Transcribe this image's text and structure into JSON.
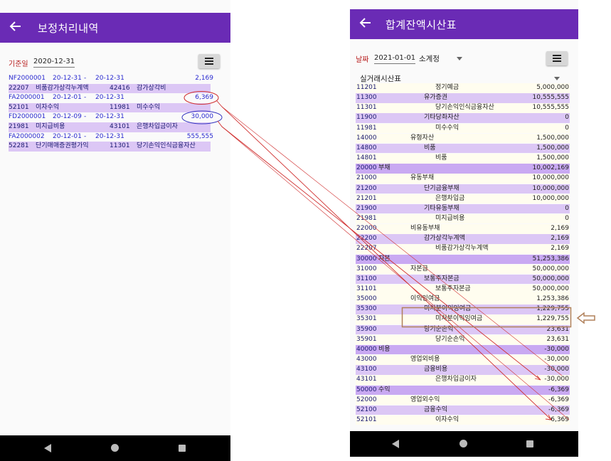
{
  "left_screen": {
    "title": "보정처리내역",
    "date_label": "기준일",
    "date_value": "2020-12-31",
    "rows": [
      {
        "kind": "header",
        "code": "NF2000001",
        "from": "20-12-31",
        "to": "20-12-31",
        "amount": "2,169"
      },
      {
        "kind": "detail",
        "debit_code": "22207",
        "debit_name": "비품감가상각누계액",
        "credit_code": "42416",
        "credit_name": "감가상각비"
      },
      {
        "kind": "header",
        "code": "FA2000001",
        "from": "20-12-01",
        "to": "20-12-31",
        "amount": "6,369"
      },
      {
        "kind": "detail",
        "debit_code": "52101",
        "debit_name": "이자수익",
        "credit_code": "11981",
        "credit_name": "미수수익"
      },
      {
        "kind": "header",
        "code": "FD2000001",
        "from": "20-12-09",
        "to": "20-12-31",
        "amount": "30,000"
      },
      {
        "kind": "detail",
        "debit_code": "21981",
        "debit_name": "미지급비용",
        "credit_code": "43101",
        "credit_name": "은행차입금이자"
      },
      {
        "kind": "header",
        "code": "FA2000002",
        "from": "20-12-01",
        "to": "20-12-31",
        "amount": "555,555"
      },
      {
        "kind": "detail",
        "debit_code": "52281",
        "debit_name": "단기매매증권평가익",
        "credit_code": "11301",
        "credit_name": "당기손익인식금융자산"
      }
    ]
  },
  "right_screen": {
    "title": "합계잔액시산표",
    "date_label": "날짜",
    "date_value": "2021-01-01",
    "mode": "소계정",
    "report": "실거래시산표",
    "rows": [
      {
        "code": "11201",
        "name": "정기예금",
        "amount": "5,000,000",
        "level": 3,
        "style": "cream"
      },
      {
        "code": "11300",
        "name": "유가증권",
        "amount": "10,555,555",
        "level": 2,
        "style": "hl"
      },
      {
        "code": "11301",
        "name": "당기손익인식금융자산",
        "amount": "10,555,555",
        "level": 3,
        "style": "cream"
      },
      {
        "code": "11900",
        "name": "기타당좌자산",
        "amount": "0",
        "level": 2,
        "style": "hl"
      },
      {
        "code": "11981",
        "name": "미수수익",
        "amount": "0",
        "level": 3,
        "style": "cream"
      },
      {
        "code": "14000",
        "name": "유형자산",
        "amount": "1,500,000",
        "level": 1,
        "style": "cream"
      },
      {
        "code": "14800",
        "name": "비품",
        "amount": "1,500,000",
        "level": 2,
        "style": "hl"
      },
      {
        "code": "14801",
        "name": "비품",
        "amount": "1,500,000",
        "level": 3,
        "style": "cream"
      },
      {
        "code": "20000",
        "name": "부채",
        "amount": "10,002,169",
        "level": 0,
        "style": "hl2"
      },
      {
        "code": "21000",
        "name": "유동부채",
        "amount": "10,000,000",
        "level": 1,
        "style": "cream"
      },
      {
        "code": "21200",
        "name": "단기금융부채",
        "amount": "10,000,000",
        "level": 2,
        "style": "hl"
      },
      {
        "code": "21201",
        "name": "은행차입금",
        "amount": "10,000,000",
        "level": 3,
        "style": "cream"
      },
      {
        "code": "21900",
        "name": "기타유동부채",
        "amount": "0",
        "level": 2,
        "style": "hl"
      },
      {
        "code": "21981",
        "name": "미지급비용",
        "amount": "0",
        "level": 3,
        "style": "cream"
      },
      {
        "code": "22000",
        "name": "비유동부채",
        "amount": "2,169",
        "level": 1,
        "style": "cream"
      },
      {
        "code": "22200",
        "name": "감가상각누계액",
        "amount": "2,169",
        "level": 2,
        "style": "hl"
      },
      {
        "code": "22207",
        "name": "비품감가상각누계액",
        "amount": "2,169",
        "level": 3,
        "style": "cream"
      },
      {
        "code": "30000",
        "name": "자본",
        "amount": "51,253,386",
        "level": 0,
        "style": "hl2"
      },
      {
        "code": "31000",
        "name": "자본금",
        "amount": "50,000,000",
        "level": 1,
        "style": "cream"
      },
      {
        "code": "31100",
        "name": "보통주자본금",
        "amount": "50,000,000",
        "level": 2,
        "style": "hl"
      },
      {
        "code": "31101",
        "name": "보통주자본금",
        "amount": "50,000,000",
        "level": 3,
        "style": "cream"
      },
      {
        "code": "35000",
        "name": "이익잉여금",
        "amount": "1,253,386",
        "level": 1,
        "style": "cream"
      },
      {
        "code": "35300",
        "name": "미처분이익잉여금",
        "amount": "1,229,755",
        "level": 2,
        "style": "hl"
      },
      {
        "code": "35301",
        "name": "미처분이익잉여금",
        "amount": "1,229,755",
        "level": 3,
        "style": "cream"
      },
      {
        "code": "35900",
        "name": "당기순손익",
        "amount": "23,631",
        "level": 2,
        "style": "hl"
      },
      {
        "code": "35901",
        "name": "당기순손익",
        "amount": "23,631",
        "level": 3,
        "style": "cream"
      },
      {
        "code": "40000",
        "name": "비용",
        "amount": "-30,000",
        "level": 0,
        "style": "hl2"
      },
      {
        "code": "43000",
        "name": "영업외비용",
        "amount": "-30,000",
        "level": 1,
        "style": "cream"
      },
      {
        "code": "43100",
        "name": "금융비용",
        "amount": "-30,000",
        "level": 2,
        "style": "hl"
      },
      {
        "code": "43101",
        "name": "은행차입금이자",
        "amount": "-30,000",
        "level": 3,
        "style": "cream"
      },
      {
        "code": "50000",
        "name": "수익",
        "amount": "-6,369",
        "level": 0,
        "style": "hl2"
      },
      {
        "code": "52000",
        "name": "영업외수익",
        "amount": "-6,369",
        "level": 1,
        "style": "cream"
      },
      {
        "code": "52100",
        "name": "금융수익",
        "amount": "-6,369",
        "level": 2,
        "style": "hl"
      },
      {
        "code": "52101",
        "name": "이자수익",
        "amount": "-6,369",
        "level": 3,
        "style": "cream"
      }
    ]
  },
  "colors": {
    "appbar": "#6a2bb5",
    "annotation_red": "#d03030",
    "annotation_blue": "#3535c0",
    "annotation_brown": "#b0805a"
  }
}
